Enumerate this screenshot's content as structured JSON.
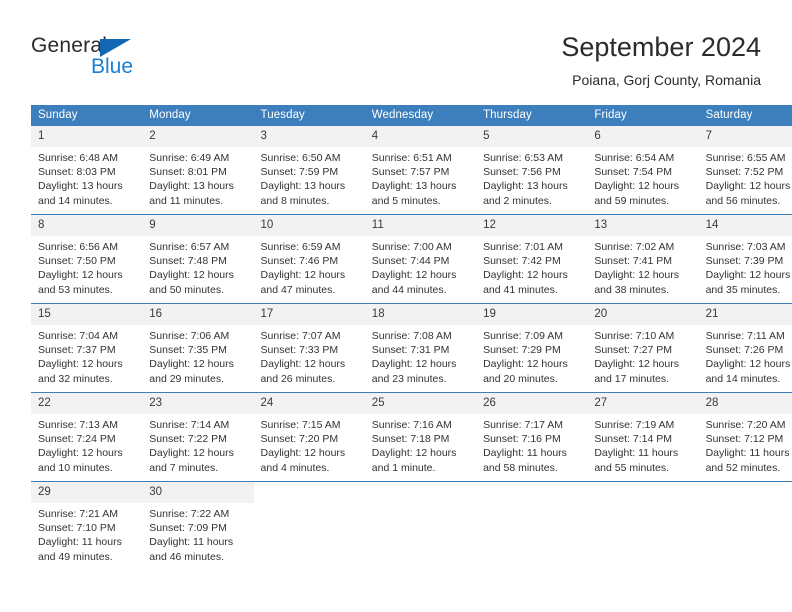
{
  "brand": {
    "name_top": "General",
    "name_bottom": "Blue",
    "triangle_color": "#1267b2",
    "blue_text_color": "#1b7fd4"
  },
  "header": {
    "title": "September 2024",
    "subtitle": "Poiana, Gorj County, Romania"
  },
  "theme": {
    "header_row_bg": "#3d7ebd",
    "header_row_text": "#ffffff",
    "daynum_bg": "#f2f2f2",
    "row_divider": "#3d7ebd",
    "page_bg": "#ffffff",
    "body_text": "#333333"
  },
  "calendar": {
    "weekday_headers": [
      "Sunday",
      "Monday",
      "Tuesday",
      "Wednesday",
      "Thursday",
      "Friday",
      "Saturday"
    ],
    "labels": {
      "sunrise": "Sunrise:",
      "sunset": "Sunset:",
      "daylight": "Daylight:"
    },
    "weeks": [
      [
        {
          "day": "1",
          "sunrise": "Sunrise: 6:48 AM",
          "sunset": "Sunset: 8:03 PM",
          "daylight_line1": "Daylight: 13 hours",
          "daylight_line2": "and 14 minutes."
        },
        {
          "day": "2",
          "sunrise": "Sunrise: 6:49 AM",
          "sunset": "Sunset: 8:01 PM",
          "daylight_line1": "Daylight: 13 hours",
          "daylight_line2": "and 11 minutes."
        },
        {
          "day": "3",
          "sunrise": "Sunrise: 6:50 AM",
          "sunset": "Sunset: 7:59 PM",
          "daylight_line1": "Daylight: 13 hours",
          "daylight_line2": "and 8 minutes."
        },
        {
          "day": "4",
          "sunrise": "Sunrise: 6:51 AM",
          "sunset": "Sunset: 7:57 PM",
          "daylight_line1": "Daylight: 13 hours",
          "daylight_line2": "and 5 minutes."
        },
        {
          "day": "5",
          "sunrise": "Sunrise: 6:53 AM",
          "sunset": "Sunset: 7:56 PM",
          "daylight_line1": "Daylight: 13 hours",
          "daylight_line2": "and 2 minutes."
        },
        {
          "day": "6",
          "sunrise": "Sunrise: 6:54 AM",
          "sunset": "Sunset: 7:54 PM",
          "daylight_line1": "Daylight: 12 hours",
          "daylight_line2": "and 59 minutes."
        },
        {
          "day": "7",
          "sunrise": "Sunrise: 6:55 AM",
          "sunset": "Sunset: 7:52 PM",
          "daylight_line1": "Daylight: 12 hours",
          "daylight_line2": "and 56 minutes."
        }
      ],
      [
        {
          "day": "8",
          "sunrise": "Sunrise: 6:56 AM",
          "sunset": "Sunset: 7:50 PM",
          "daylight_line1": "Daylight: 12 hours",
          "daylight_line2": "and 53 minutes."
        },
        {
          "day": "9",
          "sunrise": "Sunrise: 6:57 AM",
          "sunset": "Sunset: 7:48 PM",
          "daylight_line1": "Daylight: 12 hours",
          "daylight_line2": "and 50 minutes."
        },
        {
          "day": "10",
          "sunrise": "Sunrise: 6:59 AM",
          "sunset": "Sunset: 7:46 PM",
          "daylight_line1": "Daylight: 12 hours",
          "daylight_line2": "and 47 minutes."
        },
        {
          "day": "11",
          "sunrise": "Sunrise: 7:00 AM",
          "sunset": "Sunset: 7:44 PM",
          "daylight_line1": "Daylight: 12 hours",
          "daylight_line2": "and 44 minutes."
        },
        {
          "day": "12",
          "sunrise": "Sunrise: 7:01 AM",
          "sunset": "Sunset: 7:42 PM",
          "daylight_line1": "Daylight: 12 hours",
          "daylight_line2": "and 41 minutes."
        },
        {
          "day": "13",
          "sunrise": "Sunrise: 7:02 AM",
          "sunset": "Sunset: 7:41 PM",
          "daylight_line1": "Daylight: 12 hours",
          "daylight_line2": "and 38 minutes."
        },
        {
          "day": "14",
          "sunrise": "Sunrise: 7:03 AM",
          "sunset": "Sunset: 7:39 PM",
          "daylight_line1": "Daylight: 12 hours",
          "daylight_line2": "and 35 minutes."
        }
      ],
      [
        {
          "day": "15",
          "sunrise": "Sunrise: 7:04 AM",
          "sunset": "Sunset: 7:37 PM",
          "daylight_line1": "Daylight: 12 hours",
          "daylight_line2": "and 32 minutes."
        },
        {
          "day": "16",
          "sunrise": "Sunrise: 7:06 AM",
          "sunset": "Sunset: 7:35 PM",
          "daylight_line1": "Daylight: 12 hours",
          "daylight_line2": "and 29 minutes."
        },
        {
          "day": "17",
          "sunrise": "Sunrise: 7:07 AM",
          "sunset": "Sunset: 7:33 PM",
          "daylight_line1": "Daylight: 12 hours",
          "daylight_line2": "and 26 minutes."
        },
        {
          "day": "18",
          "sunrise": "Sunrise: 7:08 AM",
          "sunset": "Sunset: 7:31 PM",
          "daylight_line1": "Daylight: 12 hours",
          "daylight_line2": "and 23 minutes."
        },
        {
          "day": "19",
          "sunrise": "Sunrise: 7:09 AM",
          "sunset": "Sunset: 7:29 PM",
          "daylight_line1": "Daylight: 12 hours",
          "daylight_line2": "and 20 minutes."
        },
        {
          "day": "20",
          "sunrise": "Sunrise: 7:10 AM",
          "sunset": "Sunset: 7:27 PM",
          "daylight_line1": "Daylight: 12 hours",
          "daylight_line2": "and 17 minutes."
        },
        {
          "day": "21",
          "sunrise": "Sunrise: 7:11 AM",
          "sunset": "Sunset: 7:26 PM",
          "daylight_line1": "Daylight: 12 hours",
          "daylight_line2": "and 14 minutes."
        }
      ],
      [
        {
          "day": "22",
          "sunrise": "Sunrise: 7:13 AM",
          "sunset": "Sunset: 7:24 PM",
          "daylight_line1": "Daylight: 12 hours",
          "daylight_line2": "and 10 minutes."
        },
        {
          "day": "23",
          "sunrise": "Sunrise: 7:14 AM",
          "sunset": "Sunset: 7:22 PM",
          "daylight_line1": "Daylight: 12 hours",
          "daylight_line2": "and 7 minutes."
        },
        {
          "day": "24",
          "sunrise": "Sunrise: 7:15 AM",
          "sunset": "Sunset: 7:20 PM",
          "daylight_line1": "Daylight: 12 hours",
          "daylight_line2": "and 4 minutes."
        },
        {
          "day": "25",
          "sunrise": "Sunrise: 7:16 AM",
          "sunset": "Sunset: 7:18 PM",
          "daylight_line1": "Daylight: 12 hours",
          "daylight_line2": "and 1 minute."
        },
        {
          "day": "26",
          "sunrise": "Sunrise: 7:17 AM",
          "sunset": "Sunset: 7:16 PM",
          "daylight_line1": "Daylight: 11 hours",
          "daylight_line2": "and 58 minutes."
        },
        {
          "day": "27",
          "sunrise": "Sunrise: 7:19 AM",
          "sunset": "Sunset: 7:14 PM",
          "daylight_line1": "Daylight: 11 hours",
          "daylight_line2": "and 55 minutes."
        },
        {
          "day": "28",
          "sunrise": "Sunrise: 7:20 AM",
          "sunset": "Sunset: 7:12 PM",
          "daylight_line1": "Daylight: 11 hours",
          "daylight_line2": "and 52 minutes."
        }
      ],
      [
        {
          "day": "29",
          "sunrise": "Sunrise: 7:21 AM",
          "sunset": "Sunset: 7:10 PM",
          "daylight_line1": "Daylight: 11 hours",
          "daylight_line2": "and 49 minutes."
        },
        {
          "day": "30",
          "sunrise": "Sunrise: 7:22 AM",
          "sunset": "Sunset: 7:09 PM",
          "daylight_line1": "Daylight: 11 hours",
          "daylight_line2": "and 46 minutes."
        },
        {
          "day": "",
          "sunrise": "",
          "sunset": "",
          "daylight_line1": "",
          "daylight_line2": ""
        },
        {
          "day": "",
          "sunrise": "",
          "sunset": "",
          "daylight_line1": "",
          "daylight_line2": ""
        },
        {
          "day": "",
          "sunrise": "",
          "sunset": "",
          "daylight_line1": "",
          "daylight_line2": ""
        },
        {
          "day": "",
          "sunrise": "",
          "sunset": "",
          "daylight_line1": "",
          "daylight_line2": ""
        },
        {
          "day": "",
          "sunrise": "",
          "sunset": "",
          "daylight_line1": "",
          "daylight_line2": ""
        }
      ]
    ]
  }
}
